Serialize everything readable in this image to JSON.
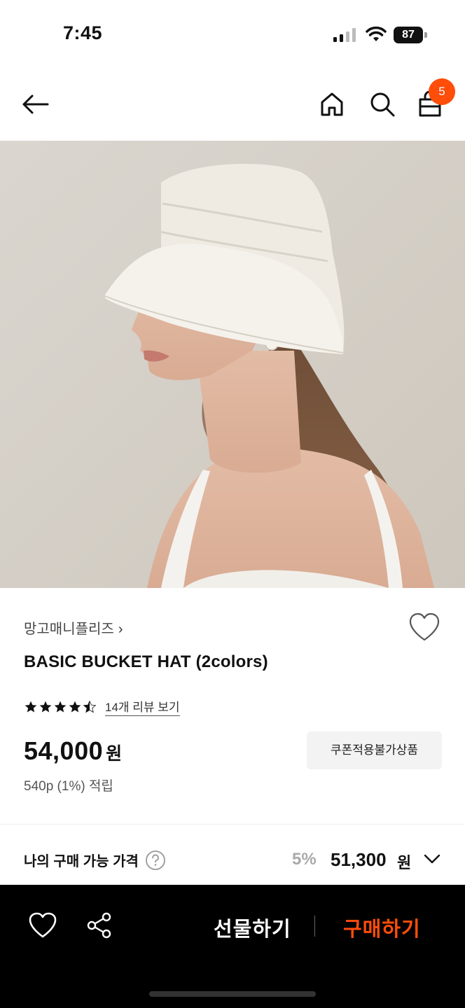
{
  "status_bar": {
    "time": "7:45",
    "battery": "87"
  },
  "nav": {
    "back_icon": "arrow-left-icon",
    "home_icon": "home-icon",
    "search_icon": "search-icon",
    "bag_icon": "shopping-bag-icon",
    "bag_count": "5"
  },
  "product": {
    "image_alt": "bucket-hat-photo",
    "brand": "망고매니플리즈",
    "brand_chevron": "›",
    "title": "BASIC BUCKET HAT (2colors)",
    "rating": 4.5,
    "review_link": "14개 리뷰 보기",
    "price": "54,000",
    "price_unit": "원",
    "coupon_label": "쿠폰적용불가상품",
    "points": "540p (1%) 적립"
  },
  "my_price": {
    "label": "나의 구매 가능 가격",
    "discount": "5%",
    "value": "51,300",
    "unit": "원"
  },
  "bottom_bar": {
    "gift_label": "선물하기",
    "buy_label": "구매하기"
  },
  "colors": {
    "accent": "#ff4d0a",
    "bottom_bar_bg": "#000000"
  }
}
